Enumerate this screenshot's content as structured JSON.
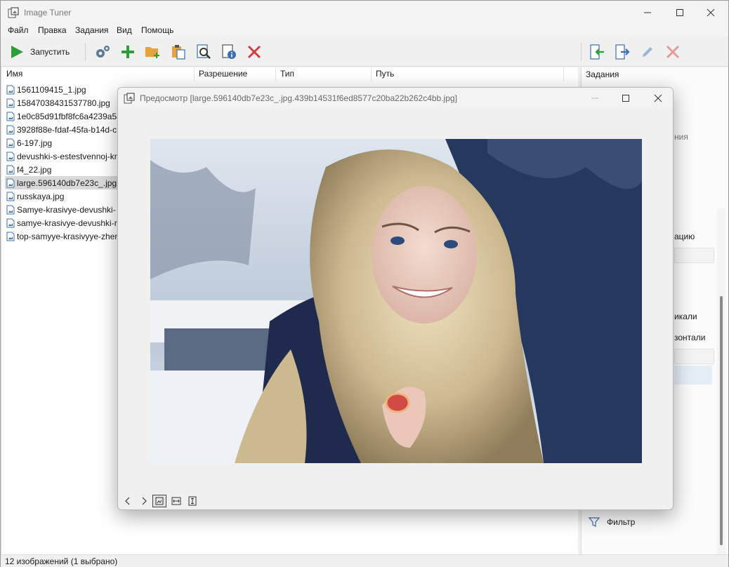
{
  "app": {
    "title": "Image Tuner",
    "icon": "app-icon"
  },
  "menu": [
    "Файл",
    "Правка",
    "Задания",
    "Вид",
    "Помощь"
  ],
  "toolbar": {
    "run_label": "Запустить",
    "icons": [
      "play-icon",
      "settings-gears-icon",
      "add-icon",
      "add-folder-icon",
      "paste-icon",
      "preview-icon",
      "info-icon",
      "delete-icon",
      "import-tasks-icon",
      "export-tasks-icon",
      "edit-icon",
      "remove-task-icon"
    ]
  },
  "filelist": {
    "columns": [
      "Имя",
      "Разрешение",
      "Тип",
      "Путь"
    ],
    "rows": [
      "1561109415_1.jpg",
      "15847038431537780.jpg",
      "1e0c85d91fbf8fc6a4239a5a",
      "3928f88e-fdaf-45fa-b14d-c",
      "6-197.jpg",
      "devushki-s-estestvennoj-kr",
      "f4_22.jpg",
      "large.596140db7e23c_.jpg.4",
      "russkaya.jpg",
      "Samye-krasivye-devushki-",
      "samye-krasivye-devushki-r",
      "top-samyye-krasivyye-zhen"
    ],
    "selected_index": 7
  },
  "tasks_panel": {
    "header": "Задания",
    "fragments": [
      "ния",
      "ацию",
      "икали",
      "зонтали"
    ],
    "filter_label": "Фильтр"
  },
  "status": {
    "text": "12 изображений (1 выбрано)"
  },
  "preview": {
    "title": "Предосмотр [large.596140db7e23c_.jpg.439b14531f6ed8577c20ba22b262c4bb.jpg]",
    "nav": [
      "prev-arrow-icon",
      "next-arrow-icon",
      "fit-to-window-icon",
      "fit-width-icon",
      "fit-height-icon"
    ],
    "active_nav": "fit-to-window-icon"
  },
  "colors": {
    "accent_green": "#2e9e3b",
    "delete_red": "#d33c3c",
    "folder_orange": "#e6a23c",
    "selected_row": "#d9d9d9"
  }
}
